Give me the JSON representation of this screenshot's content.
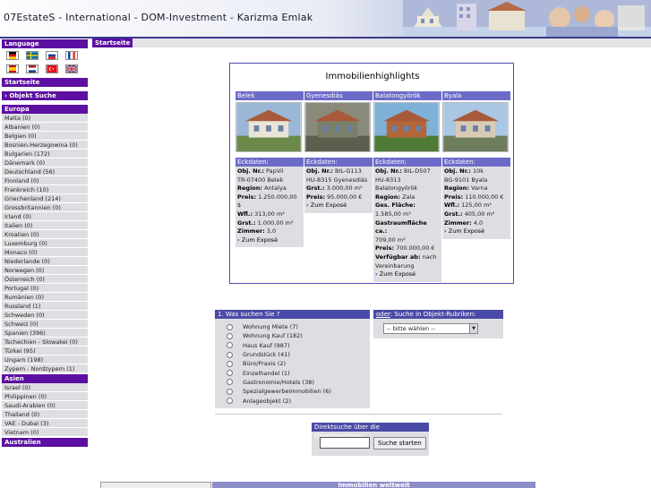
{
  "header": {
    "title": "07EstateS - International - DOM-Investment - Karizma Emlak"
  },
  "sidebar": {
    "language_heading": "Language",
    "flags": [
      "flag-de-icon",
      "flag-se-icon",
      "flag-ru-icon",
      "flag-fr-icon",
      "flag-es-icon",
      "flag-nl-icon",
      "flag-tr-icon",
      "flag-uk-icon"
    ],
    "startseite": "Startseite",
    "objekt_suche": "› Objekt Suche",
    "europa_heading": "Europa",
    "europa": [
      "Malta (0)",
      "Albanien (0)",
      "Belgien (0)",
      "Bosnien-Herzegowina (0)",
      "Bulgarien (172)",
      "Dänemark (0)",
      "Deutschland (56)",
      "Finnland (0)",
      "Frankreich (10)",
      "Griechenland (214)",
      "Grossbritannien (0)",
      "Irland (0)",
      "Italien (0)",
      "Kroatien (0)",
      "Luxemburg (0)",
      "Monaco (0)",
      "Niederlande (0)",
      "Norwegen (0)",
      "Österreich (0)",
      "Portugal (0)",
      "Rumänien (0)",
      "Russland (1)",
      "Schweden (0)",
      "Schweiz (0)",
      "Spanien (396)",
      "Tschechien - Slowakei (0)",
      "Türkei (95)",
      "Ungarn (198)",
      "Zypern - Nordzypern (1)"
    ],
    "asien_heading": "Asien",
    "asien": [
      "Israel (0)",
      "Philippinen (0)",
      "Saudi-Arabien (0)",
      "Thailand (0)",
      "VAE - Dubai (3)",
      "Vietnam (0)"
    ],
    "australien_heading": "Australien"
  },
  "breadcrumb": "Startseite",
  "highlights": {
    "title": "Immobilienhighlights",
    "cards": [
      {
        "name": "Belek",
        "eck": "Eckdaten:",
        "lines": [
          [
            "Obj. Nr.:",
            " PapVil"
          ],
          [
            "",
            "TR-07400 Belek"
          ],
          [
            "Region:",
            " Antalya"
          ],
          [
            "",
            ""
          ],
          [
            "Preis:",
            " 1.250.000,00 $"
          ],
          [
            "Wfl.:",
            " 313,00 m²"
          ],
          [
            "Grst.:",
            " 1.000,00 m²"
          ],
          [
            "Zimmer:",
            " 3,0"
          ]
        ],
        "expose": "Zum Exposé",
        "colors": [
          "#9bb7d6",
          "#e9e4d8",
          "#6b8a4a"
        ]
      },
      {
        "name": "Gyenesdiás",
        "eck": "Eckdaten:",
        "lines": [
          [
            "Obj. Nr.:",
            " BIL-G113"
          ],
          [
            "",
            "HU-8315 Gyenesdiás"
          ],
          [
            "Grst.:",
            " 3.000,00 m²"
          ],
          [
            "Preis:",
            " 95.000,00 €"
          ]
        ],
        "expose": "Zum Exposé",
        "colors": [
          "#8a8a7a",
          "#7a7f6a",
          "#5d5f4e"
        ]
      },
      {
        "name": "Balatongyörök",
        "eck": "Eckdaten:",
        "lines": [
          [
            "Obj. Nr.:",
            " BIL-D507"
          ],
          [
            "",
            "HU-8313"
          ],
          [
            "",
            "Balatongyörök"
          ],
          [
            "Region:",
            " Zala"
          ],
          [
            "",
            ""
          ],
          [
            "Ges. Fläche:",
            ""
          ],
          [
            "",
            "1.585,00 m²"
          ],
          [
            "Gastraumfläche ca.:",
            ""
          ],
          [
            "",
            "709,00 m²"
          ],
          [
            "Preis:",
            " 700.000,00 €"
          ],
          [
            "Verfügbar ab:",
            " nach"
          ],
          [
            "",
            "Vereinbarung"
          ]
        ],
        "expose": "Zum Exposé",
        "colors": [
          "#7fb0d8",
          "#b5653a",
          "#4f7a36"
        ]
      },
      {
        "name": "Byala",
        "eck": "Eckdaten:",
        "lines": [
          [
            "Obj. Nr.:",
            " 10k"
          ],
          [
            "",
            "BG-9101 Byala"
          ],
          [
            "Region:",
            " Varna"
          ],
          [
            "",
            ""
          ],
          [
            "Preis:",
            " 110.000,00 €"
          ],
          [
            "Wfl.:",
            " 125,00 m²"
          ],
          [
            "Grst.:",
            " 405,00 m²"
          ],
          [
            "Zimmer:",
            " 4,0"
          ]
        ],
        "expose": "Zum Exposé",
        "colors": [
          "#a9c6e2",
          "#d8cbb6",
          "#6e7d5c"
        ]
      }
    ]
  },
  "search": {
    "left_heading": "1. Was suchen Sie ?",
    "options": [
      "Wohnung Miete (7)",
      "Wohnung Kauf (182)",
      "Haus Kauf (987)",
      "Grundstück (41)",
      "Büro/Praxis (2)",
      "Einzelhandel (1)",
      "Gastronomie/Hotels (38)",
      "Spezialgewerbeimmobilien (6)",
      "Anlageobjekt (2)"
    ],
    "right_heading_link": "oder",
    "right_heading_rest": ": Suche in Objekt-Rubriken:",
    "select_value": "-- bitte wählen --",
    "direct_heading": "Direktsuche über die Objektnummer:",
    "direct_button": "Suche starten"
  },
  "footer": {
    "bar_text": "Immobilien weltweit"
  }
}
